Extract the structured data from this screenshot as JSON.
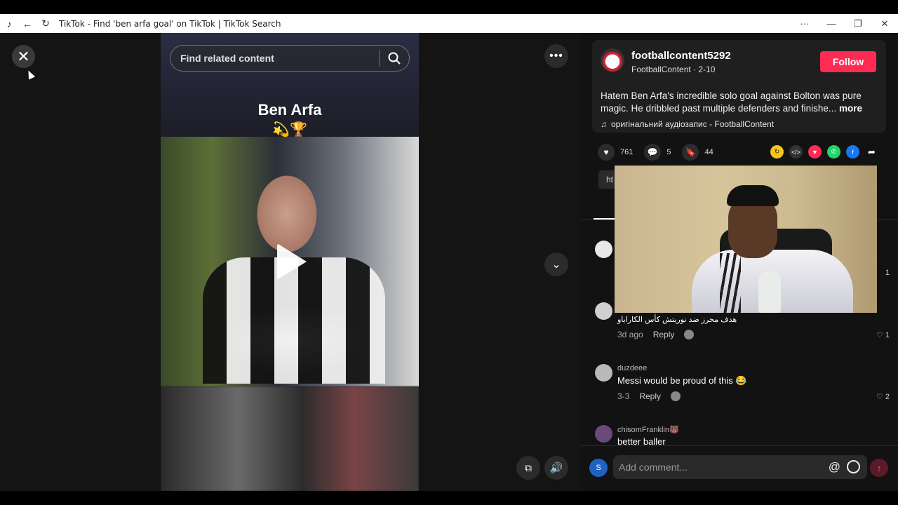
{
  "window": {
    "title": "TikTok - Find 'ben arfa goal' on TikTok | TikTok Search"
  },
  "search": {
    "placeholder": "Find related content"
  },
  "video": {
    "title": "Ben Arfa",
    "emoji": "💫🏆"
  },
  "post": {
    "author": "footballcontent5292",
    "author_sub": "FootballContent · 2-10",
    "follow_label": "Follow",
    "description": "Hatem Ben Arfa's incredible solo goal against Bolton was pure magic. He dribbled past multiple defenders and finishe...",
    "more_label": "more",
    "music": "оригінальний аудіозапис - FootballContent",
    "likes": "761",
    "comments": "5",
    "saves": "44",
    "link_chip": "ht"
  },
  "comments": [
    {
      "user": "",
      "text": "",
      "time": "",
      "likes": "1"
    },
    {
      "user": "",
      "text": "هدف محرز ضد نوريتش كأس الكاراباو",
      "time": "3d ago",
      "reply": "Reply",
      "likes": "1"
    },
    {
      "user": "duzdeee",
      "text": "Messi would be proud of this 😂",
      "time": "3-3",
      "reply": "Reply",
      "likes": "2"
    },
    {
      "user": "chisomFranklin🐻",
      "text": "better baller"
    }
  ],
  "comment_bar": {
    "avatar_letter": "S",
    "placeholder": "Add comment..."
  },
  "colors": {
    "follow": "#fe2c55",
    "panel_bg": "#121212"
  }
}
